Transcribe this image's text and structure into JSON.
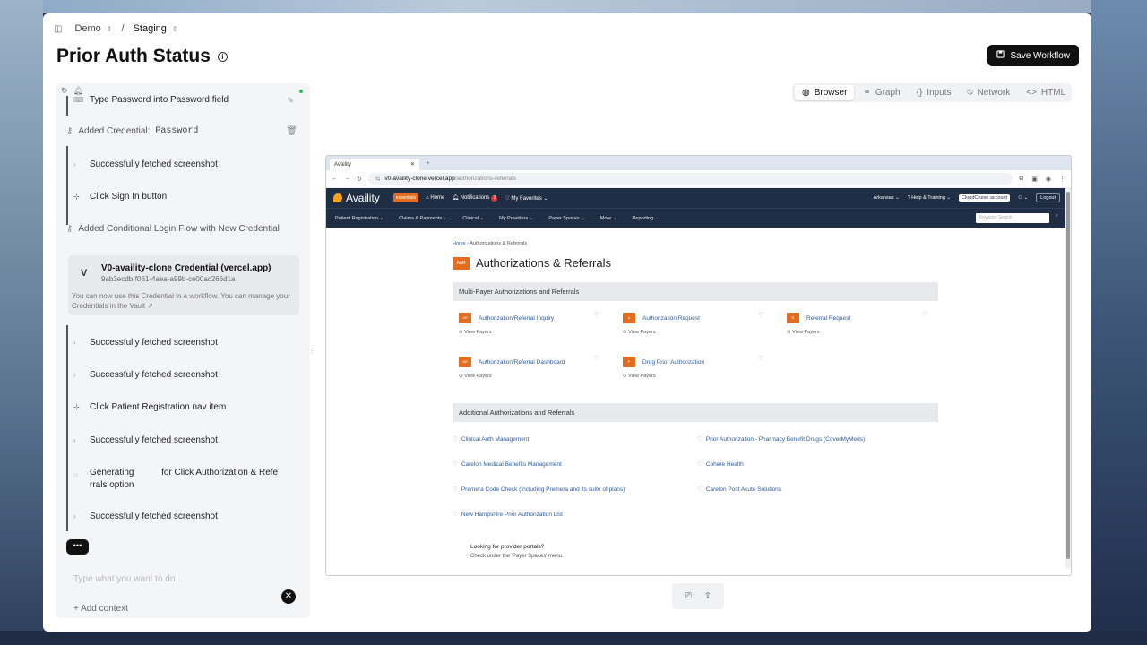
{
  "breadcrumb": {
    "project": "Demo",
    "environment": "Staging",
    "separator": "/"
  },
  "page_title": "Prior Auth Status",
  "save_button": "Save Workflow",
  "view_tabs": [
    "Browser",
    "Graph",
    "Inputs",
    "Network",
    "HTML"
  ],
  "steps": {
    "s0": "Type Password into Password field",
    "cred_added_label": "Added Credential:",
    "cred_added_value": "Password",
    "s1": "Successfully fetched screenshot",
    "s2": "Click Sign In button",
    "cond_flow": "Added Conditional Login Flow with New Credential",
    "s3": "Successfully fetched screenshot",
    "s4": "Successfully fetched screenshot",
    "s5": "Click Patient Registration nav item",
    "s6": "Successfully fetched screenshot",
    "s7a": "Generating",
    "s7b": "for Click Authorization & Refe",
    "s7c": "rrals option",
    "s8": "Successfully fetched screenshot"
  },
  "credential_card": {
    "initial": "V",
    "name": "V0-availity-clone Credential (vercel.app)",
    "id": "9ab3ecdb-f061-4aea-a99b-ce00ac266d1a",
    "note": "You can now use this Credential in a workflow. You can manage your Credentials in the Vault"
  },
  "chat": {
    "placeholder": "Type what you want to do...",
    "add_context": "Add context"
  },
  "browser": {
    "tab_title": "Availity",
    "url_host": "v0-availity-clone.vercel.app",
    "url_path": "/authorizations-referrals"
  },
  "site": {
    "logo": "Availity",
    "badge": "essentials",
    "nav1": [
      "Home",
      "Notifications",
      "My Favorites"
    ],
    "notif_count": "2",
    "right": [
      "Arkansas",
      "Help & Training",
      "CloudCruise account",
      "Logout"
    ],
    "nav2": [
      "Patient Registration",
      "Claims & Payments",
      "Clinical",
      "My Providers",
      "Payer Spaces",
      "More",
      "Reporting"
    ],
    "keyword_placeholder": "Keyword Search",
    "breadcrumb_home": "Home",
    "breadcrumb_current": "Authorizations & Referrals",
    "heading_icon": "A&R",
    "heading": "Authorizations & Referrals",
    "section1": "Multi-Payer Authorizations and Referrals",
    "tiles": [
      {
        "icon": "AR",
        "label": "Authorization/Referral Inquiry",
        "sub": "View Payers"
      },
      {
        "icon": "A",
        "label": "Authorization Request",
        "sub": "View Payers"
      },
      {
        "icon": "R",
        "label": "Referral Request",
        "sub": "View Payers"
      },
      {
        "icon": "AR",
        "label": "Authorization/Referral Dashboard",
        "sub": "View Payers"
      },
      {
        "icon": "P",
        "label": "Drug Prior Authorization",
        "sub": "View Payers"
      }
    ],
    "section2": "Additional Authorizations and Referrals",
    "links": [
      "Clinical Auth Management",
      "Prior Authorization - Pharmacy Benefit Drugs (CoverMyMeds)",
      "Carelon Medical Benefits Management",
      "Cohere Health",
      "Premera Code Check (Including Premera and its suite of plans)",
      "Carelon Post Acute Solutions",
      "New Hampshire Prior Authorization List"
    ],
    "looking_title": "Looking for provider portals?",
    "looking_sub": "Check under the 'Payer Spaces' menu."
  }
}
